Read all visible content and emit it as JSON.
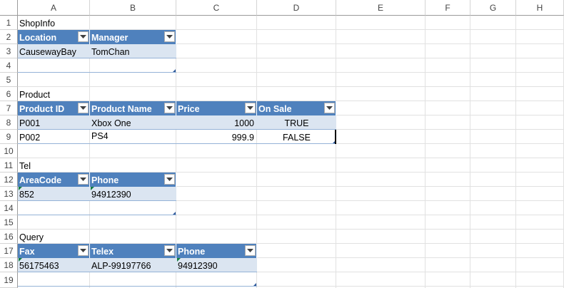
{
  "columns": [
    "A",
    "B",
    "C",
    "D",
    "E",
    "F",
    "G",
    "H"
  ],
  "rows": [
    "1",
    "2",
    "3",
    "4",
    "5",
    "6",
    "7",
    "8",
    "9",
    "10",
    "11",
    "12",
    "13",
    "14",
    "15",
    "16",
    "17",
    "18",
    "19"
  ],
  "labels": {
    "shopinfo": "ShopInfo",
    "product": "Product",
    "tel": "Tel",
    "query": "Query"
  },
  "shopinfo_table": {
    "headers": [
      "Location",
      "Manager"
    ],
    "row": [
      "CausewayBay",
      "TomChan"
    ]
  },
  "product_table": {
    "headers": [
      "Product ID",
      "Product Name",
      "Price",
      "On Sale"
    ],
    "rows": [
      [
        "P001",
        "Xbox One",
        "1000",
        "TRUE"
      ],
      [
        "P002",
        "PS4",
        "999.9",
        "FALSE"
      ]
    ]
  },
  "tel_table": {
    "headers": [
      "AreaCode",
      "Phone"
    ],
    "row": [
      "852",
      "94912390"
    ]
  },
  "query_table": {
    "headers": [
      "Fax",
      "Telex",
      "Phone"
    ],
    "row": [
      "56175463",
      "ALP-99197766",
      "94912390"
    ]
  },
  "colors": {
    "table_header": "#4f81bd",
    "table_band": "#dbe5f1",
    "table_border": "#95b3d7"
  },
  "icons": {
    "filter_dropdown": "chevron-down-icon",
    "error_indicator": "green-triangle-icon"
  }
}
